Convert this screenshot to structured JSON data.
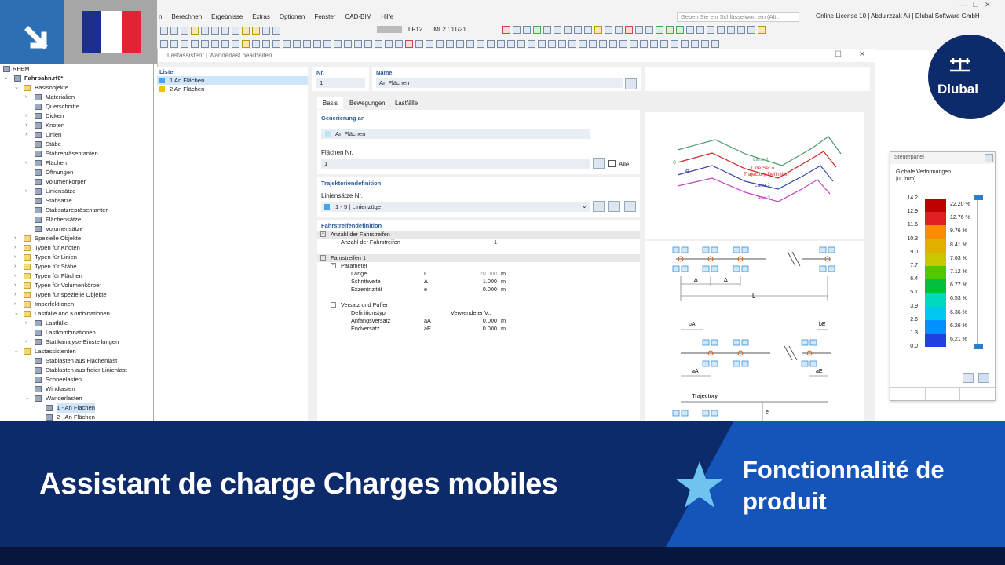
{
  "menu": [
    "n",
    "Berechnen",
    "Ergebnisse",
    "Extras",
    "Optionen",
    "Fenster",
    "CAD-BIM",
    "Hilfe"
  ],
  "search_placeholder": "Geben Sie ein Schlüsselwort ein (Alt...",
  "license": "Online License 10 | Abdulrzzak Ali | Dlubal Software GmbH",
  "toolbar": {
    "lc": "LF12",
    "ml": "ML2 : 11/21"
  },
  "dialog": {
    "title": "Lastassistent | Wanderlast bearbeiten"
  },
  "nav": {
    "root": "RFEM",
    "model": "Fahrbahn.rf6*",
    "items": [
      {
        "l": 1,
        "t": "Basisobjekte",
        "f": 1,
        "e": "⌄"
      },
      {
        "l": 2,
        "t": "Materialien",
        "e": "›"
      },
      {
        "l": 2,
        "t": "Querschnitte"
      },
      {
        "l": 2,
        "t": "Dicken",
        "e": "›"
      },
      {
        "l": 2,
        "t": "Knoten",
        "e": "›"
      },
      {
        "l": 2,
        "t": "Linien",
        "e": "›"
      },
      {
        "l": 2,
        "t": "Stäbe"
      },
      {
        "l": 2,
        "t": "Stabrepräsentanten"
      },
      {
        "l": 2,
        "t": "Flächen",
        "e": "›"
      },
      {
        "l": 2,
        "t": "Öffnungen"
      },
      {
        "l": 2,
        "t": "Volumenkörper"
      },
      {
        "l": 2,
        "t": "Liniensätze",
        "e": "›"
      },
      {
        "l": 2,
        "t": "Stabsätze"
      },
      {
        "l": 2,
        "t": "Stabsatzrepräsentanten"
      },
      {
        "l": 2,
        "t": "Flächensätze"
      },
      {
        "l": 2,
        "t": "Volumensätze"
      },
      {
        "l": 1,
        "t": "Spezielle Objekte",
        "f": 1,
        "e": "›"
      },
      {
        "l": 1,
        "t": "Typen für Knoten",
        "f": 1,
        "e": "›"
      },
      {
        "l": 1,
        "t": "Typen für Linien",
        "f": 1,
        "e": "›"
      },
      {
        "l": 1,
        "t": "Typen für Stäbe",
        "f": 1,
        "e": "›"
      },
      {
        "l": 1,
        "t": "Typen für Flächen",
        "f": 1,
        "e": "›"
      },
      {
        "l": 1,
        "t": "Typen für Volumenkörper",
        "f": 1,
        "e": "›"
      },
      {
        "l": 1,
        "t": "Typen für spezielle Objekte",
        "f": 1,
        "e": "›"
      },
      {
        "l": 1,
        "t": "Imperfektionen",
        "f": 1,
        "e": "›"
      },
      {
        "l": 1,
        "t": "Lastfälle und Kombinationen",
        "f": 1,
        "e": "⌄"
      },
      {
        "l": 2,
        "t": "Lastfälle",
        "e": "›"
      },
      {
        "l": 2,
        "t": "Lastkombinationen"
      },
      {
        "l": 2,
        "t": "Statikanalyse-Einstellungen",
        "e": "›"
      },
      {
        "l": 1,
        "t": "Lastassistenten",
        "f": 1,
        "e": "⌄"
      },
      {
        "l": 2,
        "t": "Stablasten aus Flächenlast"
      },
      {
        "l": 2,
        "t": "Stablasten aus freier Linienlast"
      },
      {
        "l": 2,
        "t": "Schneelasten"
      },
      {
        "l": 2,
        "t": "Windlasten"
      },
      {
        "l": 2,
        "t": "Wanderlasten",
        "e": "⌄"
      },
      {
        "l": 3,
        "t": "1 - An Flächen",
        "s": 1
      },
      {
        "l": 3,
        "t": "2 - An Flächen"
      }
    ]
  },
  "liste": {
    "header": "Liste",
    "items": [
      "1  An Flächen",
      "2  An Flächen"
    ],
    "colors": [
      "#4aa3e8",
      "#f2c200"
    ]
  },
  "nr": {
    "label": "Nr.",
    "value": "1"
  },
  "name": {
    "label": "Name",
    "value": "An Flächen"
  },
  "tabs": [
    "Basis",
    "Bewegungen",
    "Lastfälle"
  ],
  "gen": {
    "title": "Generierung an",
    "value": "An Flächen",
    "surf_label": "Flächen Nr.",
    "surf_value": "1",
    "all": "Alle"
  },
  "traj": {
    "title": "Trajektoriendefinition",
    "label": "Liniensätze Nr.",
    "value": "1 - 5 | Linienzüge"
  },
  "lanes": {
    "title": "Fahrstreifendefinition",
    "rows": [
      {
        "i": 0,
        "t": "Anzahl der Fahrstreifen",
        "h": 1,
        "x": "⊟"
      },
      {
        "i": 1,
        "t": "Anzahl der Fahrstreifen",
        "v": "1"
      },
      {
        "i": 0,
        "t": ""
      },
      {
        "i": 0,
        "t": "Fahrstreifen 1",
        "h": 1,
        "x": "⊟"
      },
      {
        "i": 1,
        "t": "Parameter",
        "x": "⊟"
      },
      {
        "i": 2,
        "t": "Länge",
        "s": "L",
        "v": "20.000",
        "u": "m",
        "g": 1
      },
      {
        "i": 2,
        "t": "Schrittweite",
        "s": "Δ",
        "v": "1.000",
        "u": "m"
      },
      {
        "i": 2,
        "t": "Exzentrizität",
        "s": "e",
        "v": "0.000",
        "u": "m"
      },
      {
        "i": 0,
        "t": ""
      },
      {
        "i": 1,
        "t": "Versatz und Puffer",
        "x": "⊟"
      },
      {
        "i": 2,
        "t": "Definitionstyp",
        "v": "Verwendeter V...",
        "vl": 1
      },
      {
        "i": 2,
        "t": "Anfangsversatz",
        "s": "aA",
        "v": "0.000",
        "u": "m"
      },
      {
        "i": 2,
        "t": "Endversatz",
        "s": "aE",
        "v": "0.000",
        "u": "m"
      }
    ]
  },
  "diagram": {
    "lane1": "Lane 1",
    "lineset": "Line Set =",
    "traj": "Trajectory Definition",
    "lane2": "Lane 2",
    "lane3": "Lane 3",
    "e": "e",
    "delta": "Δ",
    "L": "L",
    "bA": "bA",
    "bE": "bE",
    "aA": "aA",
    "aE": "aE",
    "trajectory": "Trajectory"
  },
  "panel": {
    "title": "Steuerpanel",
    "label1": "Globale Verformungen",
    "label2": "|u| [mm]",
    "values": [
      "14.2",
      "12.9",
      "11.6",
      "10.3",
      "9.0",
      "7.7",
      "6.4",
      "5.1",
      "3.9",
      "2.6",
      "1.3",
      "0.0"
    ],
    "pcts": [
      "22.20 %",
      "12.76 %",
      "9.76 %",
      "8.41 %",
      "7.63 %",
      "7.12 %",
      "6.77 %",
      "6.53 %",
      "6.36 %",
      "6.26 %",
      "6.21 %"
    ],
    "colors": [
      "#c00000",
      "#e02020",
      "#ff8c00",
      "#e0b000",
      "#c8c800",
      "#50c800",
      "#00c040",
      "#00d8c0",
      "#00c8f0",
      "#0090ff",
      "#2040e0",
      "#101090"
    ]
  },
  "banner": {
    "title": "Assistant de charge Charges mobiles",
    "tag1": "Fonctionnalité de",
    "tag2": "produit"
  },
  "logo": "Dlubal"
}
